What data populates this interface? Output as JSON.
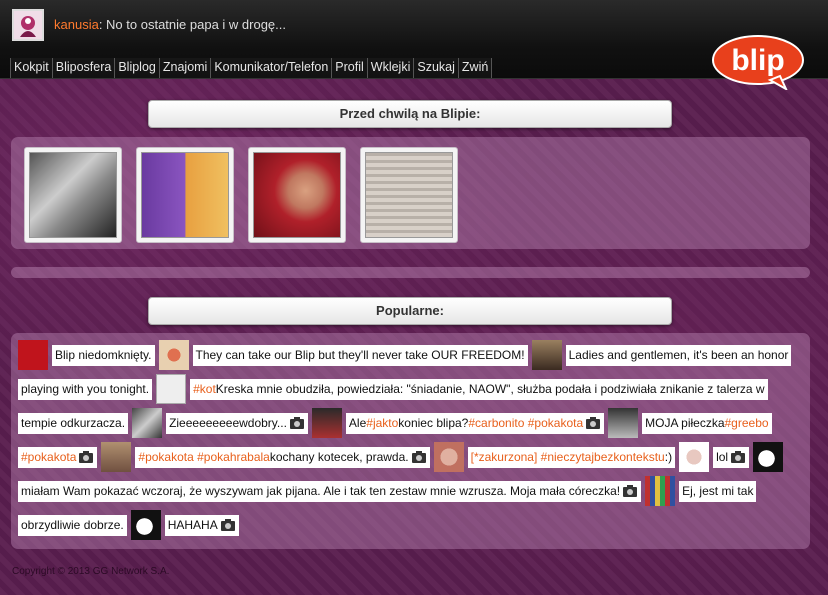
{
  "status": {
    "username": "kanusia",
    "message": "No to ostatnie papa i w drogę..."
  },
  "nav": [
    "Kokpit",
    "Bliposfera",
    "Bliplog",
    "Znajomi",
    "Komunikator/Telefon",
    "Profil",
    "Wklejki",
    "Szukaj",
    "Zwiń"
  ],
  "logo": {
    "text": "blip",
    "color": "#e8401c"
  },
  "recent": {
    "title": "Przed chwilą na Blipie:"
  },
  "popular": {
    "title": "Popularne:",
    "line1": {
      "t1": "Blip niedomknięty.",
      "t2": "They can take our Blip but they'll never take OUR FREEDOM!",
      "t3": "Ladies and gentlemen, it's been an honor"
    },
    "line2": {
      "t1": "playing with you tonight.",
      "tag1": "#kot",
      "t2": " Kreska mnie obudziła, powiedziała: \"śniadanie, NAOW\", służba podała i podziwiała znikanie z talerza w"
    },
    "line3": {
      "t1": "tempie odkurzacza.",
      "t2": "Zieeeeeeeeewdobry...",
      "t3": "Ale ",
      "tag1": "#jakto",
      "t4": " koniec blipa? ",
      "tag2": "#carbonito",
      "tag3": "#pokakota",
      "t5": "MOJA piłeczka ",
      "tag4": "#greebo"
    },
    "line4": {
      "tag1": "#pokakota",
      "tag2": "#pokakota",
      "tag3": "#pokahrabala",
      "t1": " kochany kotecek, prawda.",
      "tag4": "[*zakurzona]",
      "tag5": "#nieczytajbezkontekstu",
      "t2": " :)",
      "t3": "lol"
    },
    "line5": {
      "t1": "miałam Wam pokazać wczoraj, że wyszywam jak pijana. Ale i tak ten zestaw mnie wzrusza. Moja mała córeczka!",
      "t2": "Ej, jest mi tak"
    },
    "line6": {
      "t1": "obrzydliwie dobrze.",
      "t2": "HAHAHA"
    }
  },
  "copyright": "Copyright © 2013 GG Network S.A."
}
